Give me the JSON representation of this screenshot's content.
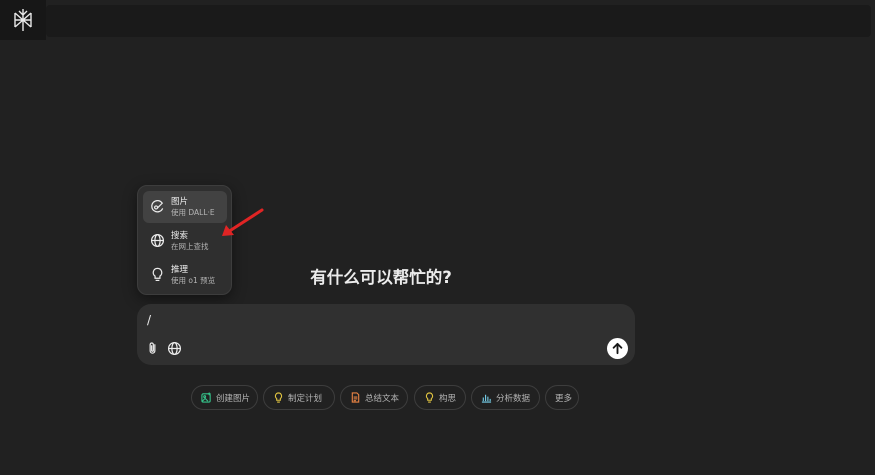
{
  "app": {
    "heading": "有什么可以帮忙的?"
  },
  "tools_menu": {
    "items": [
      {
        "title": "图片",
        "subtitle": "使用 DALL·E",
        "icon": "image-brush-icon"
      },
      {
        "title": "搜索",
        "subtitle": "在网上查找",
        "icon": "globe-icon"
      },
      {
        "title": "推理",
        "subtitle": "使用 o1 预览",
        "icon": "lightbulb-icon"
      }
    ]
  },
  "composer": {
    "text": "/"
  },
  "suggestions": [
    {
      "label": "创建图片",
      "icon": "create-image-icon",
      "color": "#35c38a"
    },
    {
      "label": "制定计划",
      "icon": "lightbulb-icon",
      "color": "#e2c541"
    },
    {
      "label": "总结文本",
      "icon": "document-icon",
      "color": "#ea8444"
    },
    {
      "label": "构思",
      "icon": "lightbulb-icon",
      "color": "#e2c541"
    },
    {
      "label": "分析数据",
      "icon": "chart-icon",
      "color": "#76d0eb"
    },
    {
      "label": "更多",
      "icon": "",
      "color": ""
    }
  ],
  "colors": {
    "background": "#212121",
    "annotation_arrow": "#e02424"
  }
}
